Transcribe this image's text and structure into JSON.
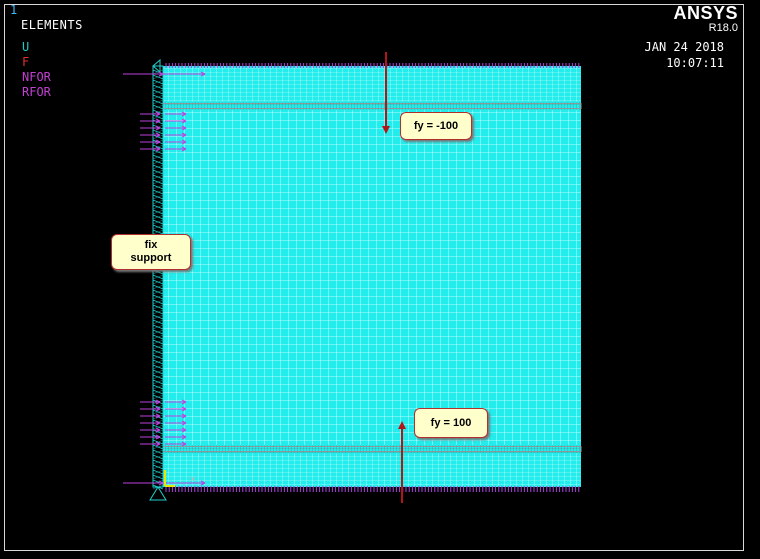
{
  "window_number": "1",
  "plot_title": "ELEMENTS",
  "legend": [
    {
      "label": "U",
      "color": "#20c8c8"
    },
    {
      "label": "F",
      "color": "#e03030"
    },
    {
      "label": "NFOR",
      "color": "#c040d0"
    },
    {
      "label": "RFOR",
      "color": "#c040d0"
    }
  ],
  "brand": {
    "name": "ANSYS",
    "version": "R18.0"
  },
  "timestamp": {
    "date": "JAN 24 2018",
    "time": "10:07:11"
  },
  "colors": {
    "mesh_fill": "#22ecec",
    "mesh_lines": "#e6ffff",
    "dense_band": "#9aa6a6",
    "force_arrow": "#b01818",
    "nfor": "#b040e0",
    "constraint": "#20d0d0"
  },
  "annotations": {
    "top_force": {
      "line1": "fy = -100"
    },
    "bottom_force": {
      "line1": "fy = 100"
    },
    "support": {
      "line1": "fix",
      "line2": "support"
    }
  }
}
